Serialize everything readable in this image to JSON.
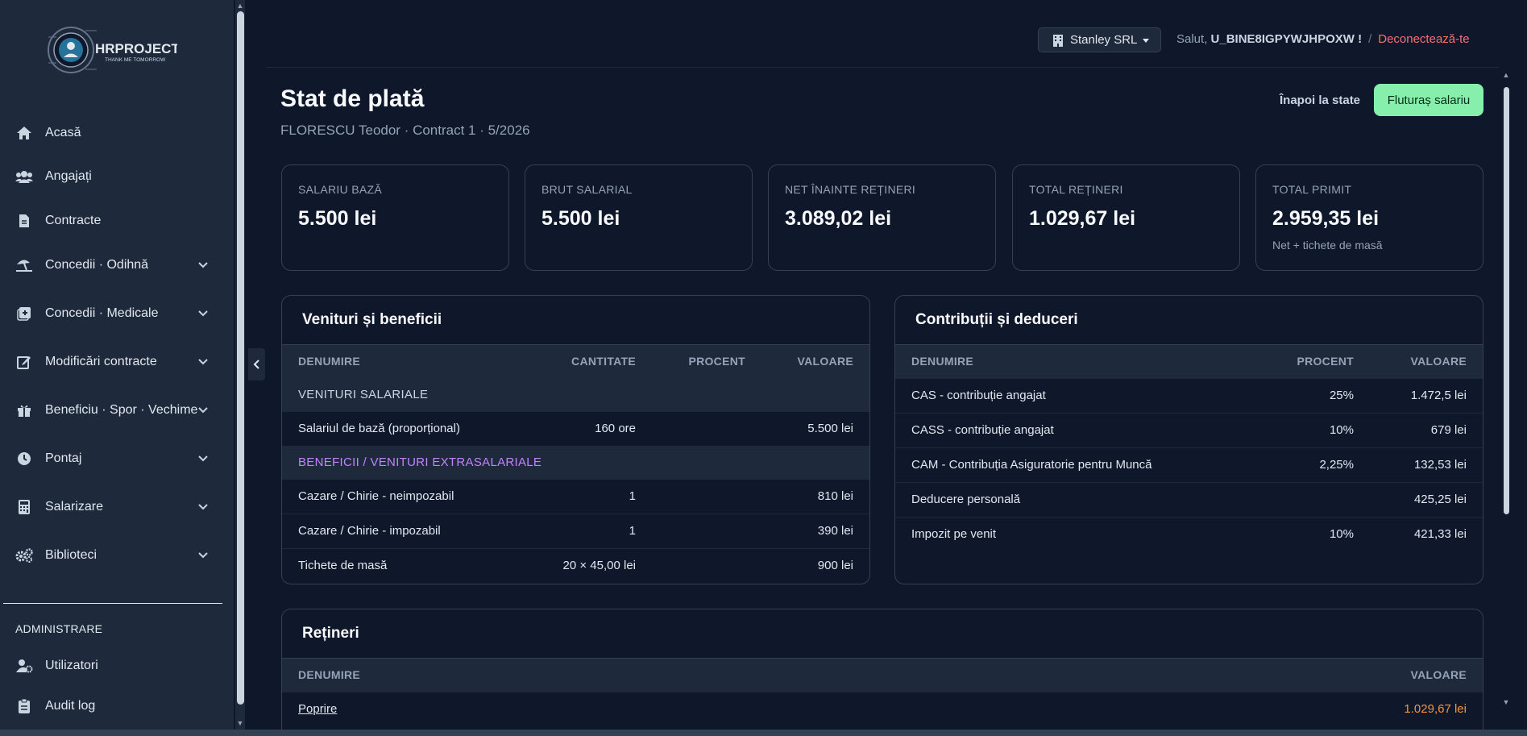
{
  "app": {
    "logo_name": "HRPROJECT",
    "logo_tagline": "THANK ME TOMORROW"
  },
  "sidebar": {
    "items": [
      {
        "label": "Acasă",
        "icon": "home-icon",
        "expandable": false
      },
      {
        "label": "Angajați",
        "icon": "users-icon",
        "expandable": false
      },
      {
        "label": "Contracte",
        "icon": "file-icon",
        "expandable": false
      },
      {
        "label": "Concedii · Odihnă",
        "icon": "umbrella-beach-icon",
        "expandable": true
      },
      {
        "label": "Concedii · Medicale",
        "icon": "medical-icon",
        "expandable": true
      },
      {
        "label": "Modificări contracte",
        "icon": "edit-icon",
        "expandable": true
      },
      {
        "label": "Beneficiu · Spor · Vechime",
        "icon": "gift-icon",
        "expandable": true
      },
      {
        "label": "Pontaj",
        "icon": "clock-icon",
        "expandable": true
      },
      {
        "label": "Salarizare",
        "icon": "calculator-icon",
        "expandable": true
      },
      {
        "label": "Biblioteci",
        "icon": "cogs-icon",
        "expandable": true
      }
    ],
    "admin_section": "ADMINISTRARE",
    "admin_items": [
      {
        "label": "Utilizatori",
        "icon": "user-cog-icon"
      },
      {
        "label": "Audit log",
        "icon": "clipboard-icon"
      }
    ]
  },
  "topbar": {
    "company": "Stanley SRL",
    "greeting": "Salut,",
    "username": "U_BINE8IGPYWJHPOXW !",
    "separator": "/",
    "logout": "Deconectează-te"
  },
  "page": {
    "title": "Stat de plată",
    "subtitle": "FLORESCU Teodor · Contract 1 · 5/2026",
    "back_link": "Înapoi la state",
    "payslip_button": "Fluturaș salariu"
  },
  "stats": [
    {
      "label": "SALARIU BAZĂ",
      "value": "5.500 lei",
      "note": ""
    },
    {
      "label": "BRUT SALARIAL",
      "value": "5.500 lei",
      "note": ""
    },
    {
      "label": "NET ÎNAINTE REȚINERI",
      "value": "3.089,02 lei",
      "note": ""
    },
    {
      "label": "TOTAL REȚINERI",
      "value": "1.029,67 lei",
      "note": "",
      "color": "#fb923c"
    },
    {
      "label": "TOTAL PRIMIT",
      "value": "2.959,35 lei",
      "note": "Net + tichete de masă",
      "color": "#34d399"
    }
  ],
  "income": {
    "title": "Venituri și beneficii",
    "headers": [
      "DENUMIRE",
      "CANTITATE",
      "PROCENT",
      "VALOARE"
    ],
    "group_salary": "VENITURI SALARIALE",
    "salary_rows": [
      {
        "name": "Salariul de bază (proporțional)",
        "qty": "160 ore",
        "pct": "",
        "value": "5.500 lei"
      }
    ],
    "group_benefits": "BENEFICII / VENITURI EXTRASALARIALE",
    "benefit_rows": [
      {
        "name": "Cazare / Chirie - neimpozabil",
        "qty": "1",
        "pct": "",
        "value": "810 lei"
      },
      {
        "name": "Cazare / Chirie - impozabil",
        "qty": "1",
        "pct": "",
        "value": "390 lei"
      },
      {
        "name": "Tichete de masă",
        "qty": "20 × 45,00 lei",
        "pct": "",
        "value": "900 lei"
      }
    ]
  },
  "contributions": {
    "title": "Contribuții și deduceri",
    "headers": [
      "DENUMIRE",
      "PROCENT",
      "VALOARE"
    ],
    "rows": [
      {
        "name": "CAS - contribuție angajat",
        "pct": "25%",
        "value": "1.472,5 lei"
      },
      {
        "name": "CASS - contribuție angajat",
        "pct": "10%",
        "value": "679 lei"
      },
      {
        "name": "CAM - Contribuția Asiguratorie pentru Muncă",
        "pct": "2,25%",
        "value": "132,53 lei"
      },
      {
        "name": "Deducere personală",
        "pct": "",
        "value": "425,25 lei"
      },
      {
        "name": "Impozit pe venit",
        "pct": "10%",
        "value": "421,33 lei"
      }
    ]
  },
  "deductions": {
    "title": "Rețineri",
    "headers": [
      "DENUMIRE",
      "VALOARE"
    ],
    "rows": [
      {
        "name": "Poprire",
        "value": "1.029,67 lei"
      }
    ]
  }
}
